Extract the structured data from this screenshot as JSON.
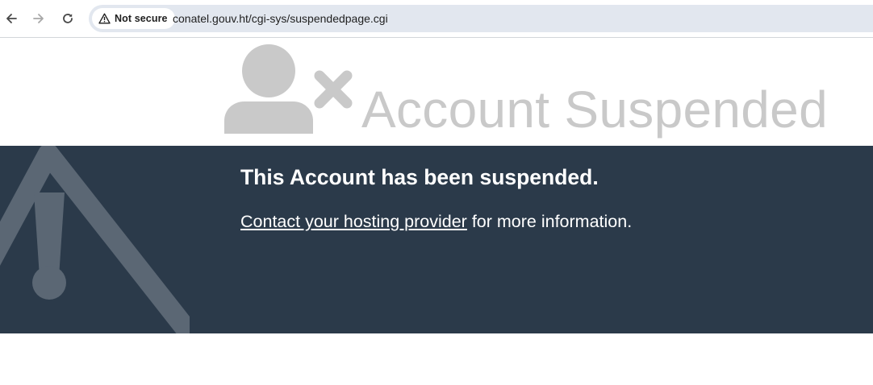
{
  "browser": {
    "security_label": "Not secure",
    "url": "conatel.gouv.ht/cgi-sys/suspendedpage.cgi",
    "icons": [
      "back-arrow-icon",
      "forward-arrow-icon",
      "reload-icon",
      "warning-triangle-icon"
    ]
  },
  "hero": {
    "title": "Account Suspended",
    "icons": [
      "user-icon",
      "x-icon"
    ]
  },
  "notice": {
    "heading": "This Account has been suspended.",
    "link_text": "Contact your hosting provider",
    "trailing_text": " for more information.",
    "icons": [
      "warning-icon"
    ]
  },
  "colors": {
    "band_background": "#2b3a4a",
    "title_gray": "#c9c9c9",
    "warning_icon": "#5b6774"
  }
}
